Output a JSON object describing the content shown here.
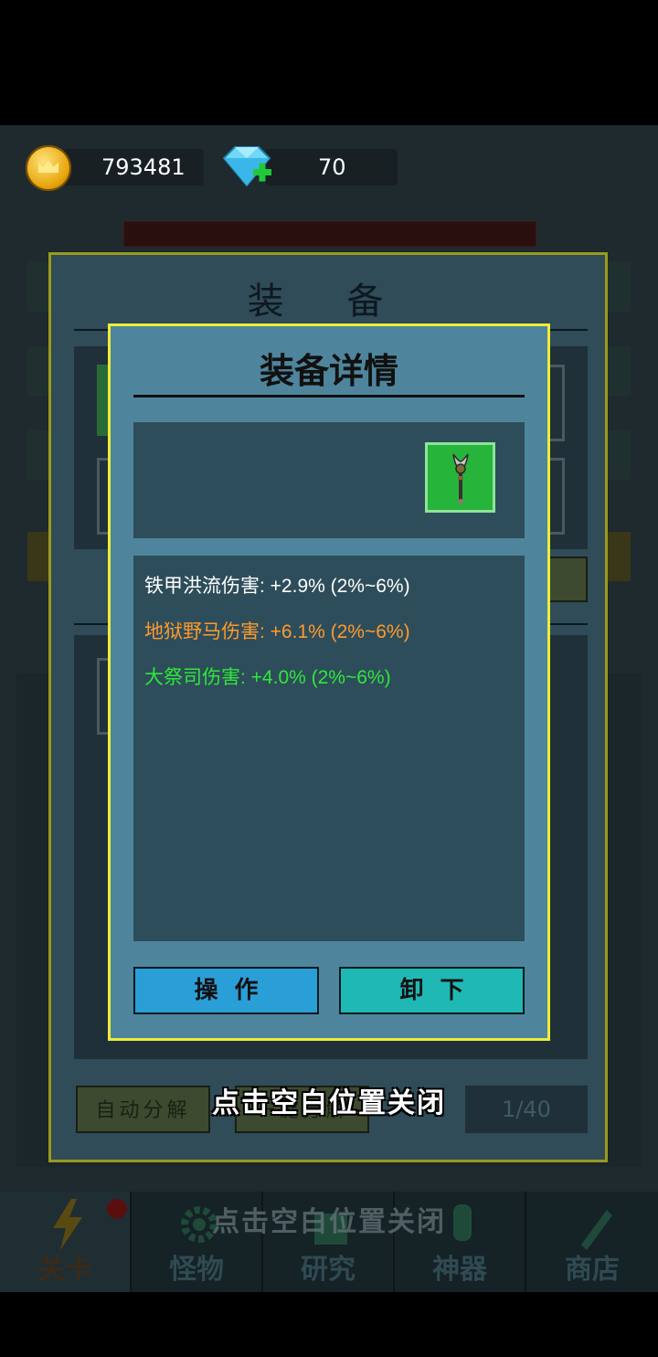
{
  "currency": {
    "coins": "793481",
    "gems": "70"
  },
  "equip_window": {
    "title": "装 备",
    "auto_decompose_label": "自动分解",
    "one_click_label": "一键分解",
    "slot_count": "1/40"
  },
  "dialog": {
    "title": "装备详情",
    "item_icon": "staff-icon",
    "stats": [
      {
        "text": "铁甲洪流伤害: +2.9% (2%~6%)",
        "color": "#ffffff"
      },
      {
        "text": "地狱野马伤害: +6.1% (2%~6%)",
        "color": "#ff9a2e"
      },
      {
        "text": "大祭司伤害: +4.0% (2%~6%)",
        "color": "#2ee83a"
      }
    ],
    "operate_label": "操作",
    "unequip_label": "卸下",
    "operate_color": "#2a9ed6",
    "unequip_color": "#1fb8b4"
  },
  "hints": {
    "close_hint": "点击空白位置关闭",
    "close_hint_ghost": "点击空白位置关闭"
  },
  "nav": {
    "items": [
      {
        "label": "关卡",
        "icon": "lightning-icon"
      },
      {
        "label": "怪物",
        "icon": "gear-icon"
      },
      {
        "label": "研究",
        "icon": "book-icon"
      },
      {
        "label": "神器",
        "icon": "artifact-icon"
      },
      {
        "label": "商店",
        "icon": "shop-icon"
      }
    ]
  }
}
